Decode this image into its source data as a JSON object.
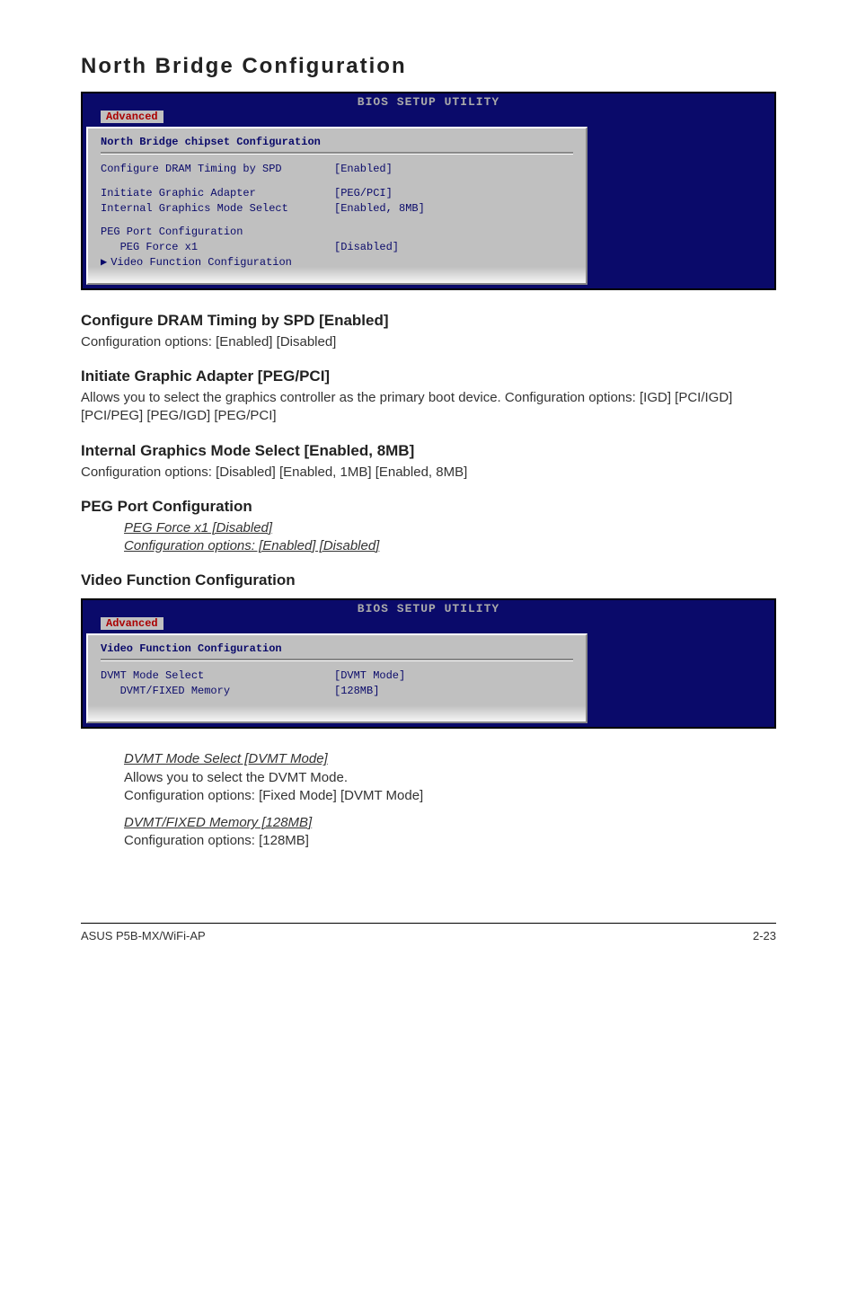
{
  "page_title": "North Bridge Configuration",
  "bios1": {
    "header": "BIOS SETUP UTILITY",
    "tab": "Advanced",
    "section_title": "North Bridge chipset Configuration",
    "rows": {
      "r1_label": "Configure DRAM Timing by SPD",
      "r1_value": "[Enabled]",
      "r2_label": "Initiate Graphic Adapter",
      "r2_value": "[PEG/PCI]",
      "r3_label": "Internal Graphics Mode Select",
      "r3_value": "[Enabled, 8MB]",
      "r4_label": "PEG Port Configuration",
      "r5_label": "   PEG Force x1",
      "r5_value": "[Disabled]",
      "r6_label": "Video Function Configuration"
    }
  },
  "sec1": {
    "heading": "Configure DRAM Timing by SPD [Enabled]",
    "body": "Configuration options: [Enabled] [Disabled]"
  },
  "sec2": {
    "heading": "Initiate Graphic Adapter [PEG/PCI]",
    "body": "Allows you to select the graphics controller as the primary boot device. Configuration options: [IGD] [PCI/IGD] [PCI/PEG] [PEG/IGD] [PEG/PCI]"
  },
  "sec3": {
    "heading": "Internal Graphics Mode Select [Enabled, 8MB]",
    "body": "Configuration options: [Disabled] [Enabled, 1MB] [Enabled, 8MB]"
  },
  "sec4": {
    "heading": "PEG Port Configuration",
    "line1": "PEG Force x1 [Disabled]",
    "line2": "Configuration options: [Enabled] [Disabled] "
  },
  "sec5": {
    "heading": "Video Function Configuration"
  },
  "bios2": {
    "header": "BIOS SETUP UTILITY",
    "tab": "Advanced",
    "section_title": "Video Function Configuration",
    "rows": {
      "r1_label": "DVMT Mode Select",
      "r1_value": "[DVMT Mode]",
      "r2_label": "   DVMT/FIXED Memory",
      "r2_value": "[128MB]"
    }
  },
  "sec6": {
    "line1": "DVMT Mode Select [DVMT Mode]",
    "body1a": "Allows you to select the DVMT Mode.",
    "body1b": "Configuration options: [Fixed Mode] [DVMT Mode]",
    "line2": "DVMT/FIXED Memory [128MB]",
    "body2": "Configuration options: [128MB]"
  },
  "footer": {
    "left": "ASUS P5B-MX/WiFi-AP",
    "right": "2-23"
  }
}
